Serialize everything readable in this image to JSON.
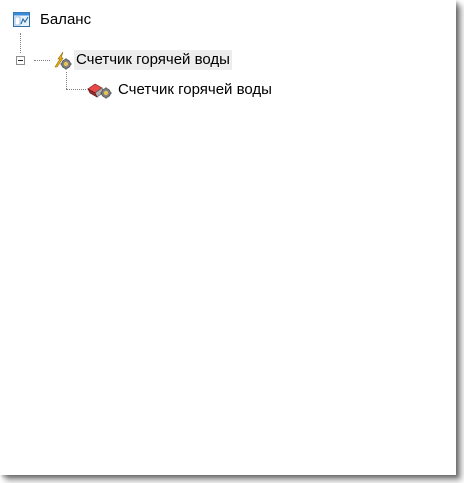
{
  "tree": {
    "root": {
      "label": "Баланс",
      "icon": "balance-report-icon"
    },
    "node1": {
      "label": "Счетчик горячей воды",
      "icon": "meter-lightning-gear-icon",
      "expanded": true,
      "selected": true
    },
    "node2": {
      "label": "Счетчик горячей воды",
      "icon": "meter-device-gear-icon"
    }
  }
}
